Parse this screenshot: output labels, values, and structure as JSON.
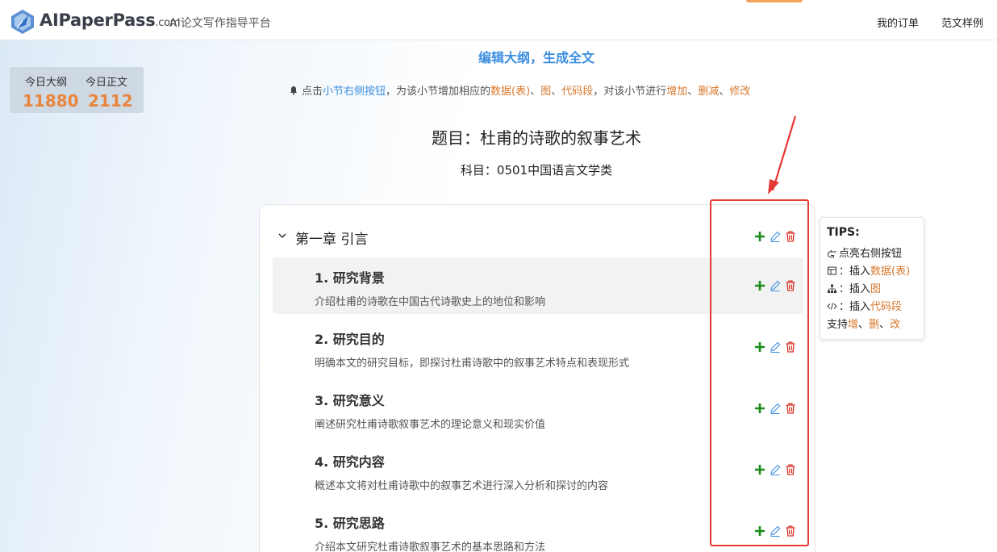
{
  "header": {
    "logo_main": "AIPaperPass",
    "logo_suffix": ".com",
    "tagline": "AI论文写作指导平台",
    "nav": [
      "我的订单",
      "范文样例"
    ]
  },
  "stats": {
    "outline_label": "今日大纲",
    "outline_value": "11880",
    "body_label": "今日正文",
    "body_value": "2112"
  },
  "heading": "编辑大纲，生成全文",
  "hint": {
    "p1": "点击",
    "p2": "小节右侧按钮",
    "p3": "，为该小节增加相应的",
    "p4": "数据(表)",
    "p5": "、",
    "p6": "图",
    "p7": "、",
    "p8": "代码段",
    "p9": "，对该小节进行",
    "p10": "增加",
    "p11": "、",
    "p12": "删减",
    "p13": "、",
    "p14": "修改"
  },
  "title": "题目：杜甫的诗歌的叙事艺术",
  "subject": "科目：0501中国语言文学类",
  "outline": {
    "chapter": "第一章 引言",
    "sections": [
      {
        "title": "1. 研究背景",
        "desc": "介绍杜甫的诗歌在中国古代诗歌史上的地位和影响"
      },
      {
        "title": "2. 研究目的",
        "desc": "明确本文的研究目标，即探讨杜甫诗歌中的叙事艺术特点和表现形式"
      },
      {
        "title": "3. 研究意义",
        "desc": "阐述研究杜甫诗歌叙事艺术的理论意义和现实价值"
      },
      {
        "title": "4. 研究内容",
        "desc": "概述本文将对杜甫诗歌中的叙事艺术进行深入分析和探讨的内容"
      },
      {
        "title": "5. 研究思路",
        "desc": "介绍本文研究杜甫诗歌叙事艺术的基本思路和方法"
      }
    ]
  },
  "tips": {
    "title": "TIPS:",
    "line1": "点亮右侧按钮",
    "line2a": "：插入",
    "line2b": "数据(表)",
    "line3a": "：插入",
    "line3b": "图",
    "line4a": "：插入",
    "line4b": "代码段",
    "line5a": "支持",
    "line5b": "增",
    "line5c": "、",
    "line5d": "删",
    "line5e": "、",
    "line5f": "改"
  },
  "colors": {
    "accent_blue": "#3d8ee0",
    "accent_orange": "#d9782c",
    "stat_orange": "#e8853d",
    "add_green": "#1a8a1a",
    "edit_blue": "#3d8ee0",
    "delete_red": "#d93025",
    "highlight_red": "#e53935"
  },
  "icons": [
    "logo-icon",
    "bell-icon",
    "chevron-down-icon",
    "plus-icon",
    "pencil-icon",
    "trash-icon",
    "pointing-hand-icon",
    "table-icon",
    "diagram-icon",
    "code-icon",
    "arrow-icon"
  ]
}
